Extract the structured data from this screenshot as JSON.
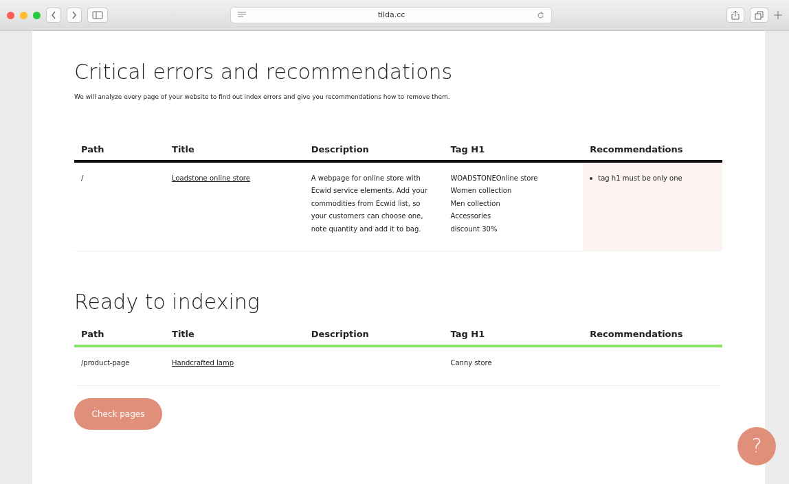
{
  "browser": {
    "address": "tilda.cc"
  },
  "critical": {
    "title": "Critical errors and recommendations",
    "subtitle": "We will analyze every page of your website to find out index errors and give you recommendations how to remove them.",
    "columns": [
      "Path",
      "Title",
      "Description",
      "Tag H1",
      "Recommendations"
    ],
    "rows": [
      {
        "path": "/",
        "title": "Loadstone online store",
        "description": "A webpage for online store with Ecwid service elements. Add your commodities from Ecwid list, so your customers can choose one, note quantity and add it to bag.",
        "tag_h1": [
          "WOADSTONEOnline store",
          "Women collection",
          "Men collection",
          "Accessories",
          "discount 30%"
        ],
        "recommendations": [
          "tag h1 must be only one"
        ]
      }
    ]
  },
  "ready": {
    "title": "Ready to indexing",
    "columns": [
      "Path",
      "Title",
      "Description",
      "Tag H1",
      "Recommendations"
    ],
    "rows": [
      {
        "path": "/product-page",
        "title": "Handcrafted lamp",
        "tag_h1": [
          "Canny store"
        ]
      }
    ]
  },
  "check_button": "Check pages",
  "help_button": "?"
}
